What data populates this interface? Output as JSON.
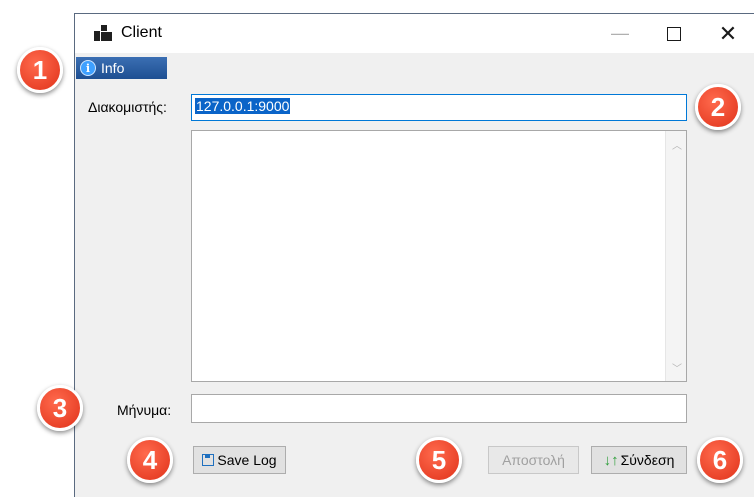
{
  "window": {
    "title": "Client"
  },
  "titlebar": {
    "minimize": "—",
    "close": "✕"
  },
  "info_button": {
    "label": "Info"
  },
  "server": {
    "label": "Διακομιστής:",
    "value": "127.0.0.1:9000"
  },
  "message": {
    "label": "Μήνυμα:",
    "value": ""
  },
  "buttons": {
    "save_log": "Save Log",
    "send": "Αποστολή",
    "connect": "Σύνδεση"
  },
  "callouts": [
    "1",
    "2",
    "3",
    "4",
    "5",
    "6"
  ]
}
